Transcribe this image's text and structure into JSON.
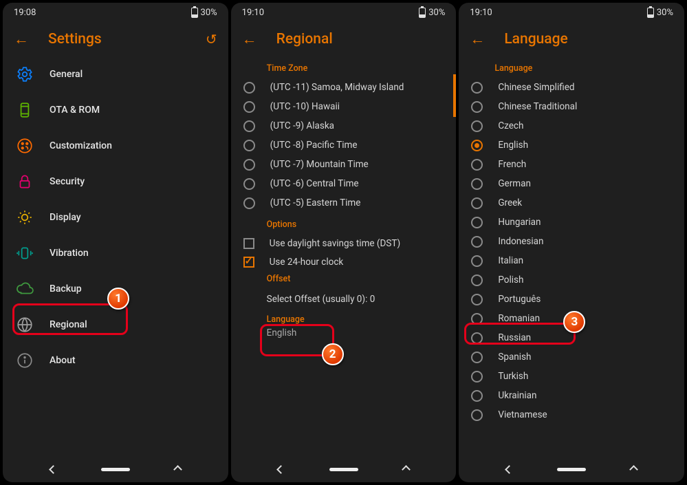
{
  "status": {
    "battery": "30%"
  },
  "times": [
    "19:08",
    "19:10",
    "19:10"
  ],
  "screens": {
    "settings": {
      "title": "Settings",
      "items": [
        {
          "label": "General",
          "id": "general",
          "iconColor": "#0b80ff"
        },
        {
          "label": "OTA & ROM",
          "id": "ota-rom",
          "iconColor": "#5fb700"
        },
        {
          "label": "Customization",
          "id": "customization",
          "iconColor": "#ff6a00"
        },
        {
          "label": "Security",
          "id": "security",
          "iconColor": "#e6006f"
        },
        {
          "label": "Display",
          "id": "display",
          "iconColor": "#e8b000"
        },
        {
          "label": "Vibration",
          "id": "vibration",
          "iconColor": "#009e8e"
        },
        {
          "label": "Backup",
          "id": "backup",
          "iconColor": "#3f9a3f"
        },
        {
          "label": "Regional",
          "id": "regional",
          "iconColor": "#9e9e9e"
        },
        {
          "label": "About",
          "id": "about",
          "iconColor": "#8a8a8a"
        }
      ]
    },
    "regional": {
      "title": "Regional",
      "timezone_title": "Time Zone",
      "timezones": [
        "(UTC -11) Samoa, Midway Island",
        "(UTC -10) Hawaii",
        "(UTC -9) Alaska",
        "(UTC -8) Pacific Time",
        "(UTC -7) Mountain Time",
        "(UTC -6) Central Time",
        "(UTC -5) Eastern Time"
      ],
      "options_title": "Options",
      "options": [
        {
          "label": "Use daylight savings time (DST)",
          "checked": false
        },
        {
          "label": "Use 24-hour clock",
          "checked": true
        }
      ],
      "offset_title": "Offset",
      "offset_text": "Select Offset (usually 0): 0",
      "language_title": "Language",
      "language_value": "English"
    },
    "language": {
      "title": "Language",
      "section_title": "Language",
      "selected": "English",
      "items": [
        "Chinese Simplified",
        "Chinese Traditional",
        "Czech",
        "English",
        "French",
        "German",
        "Greek",
        "Hungarian",
        "Indonesian",
        "Italian",
        "Polish",
        "Português",
        "Romanian",
        "Russian",
        "Spanish",
        "Turkish",
        "Ukrainian",
        "Vietnamese"
      ]
    }
  },
  "annotations": [
    "1",
    "2",
    "3"
  ]
}
